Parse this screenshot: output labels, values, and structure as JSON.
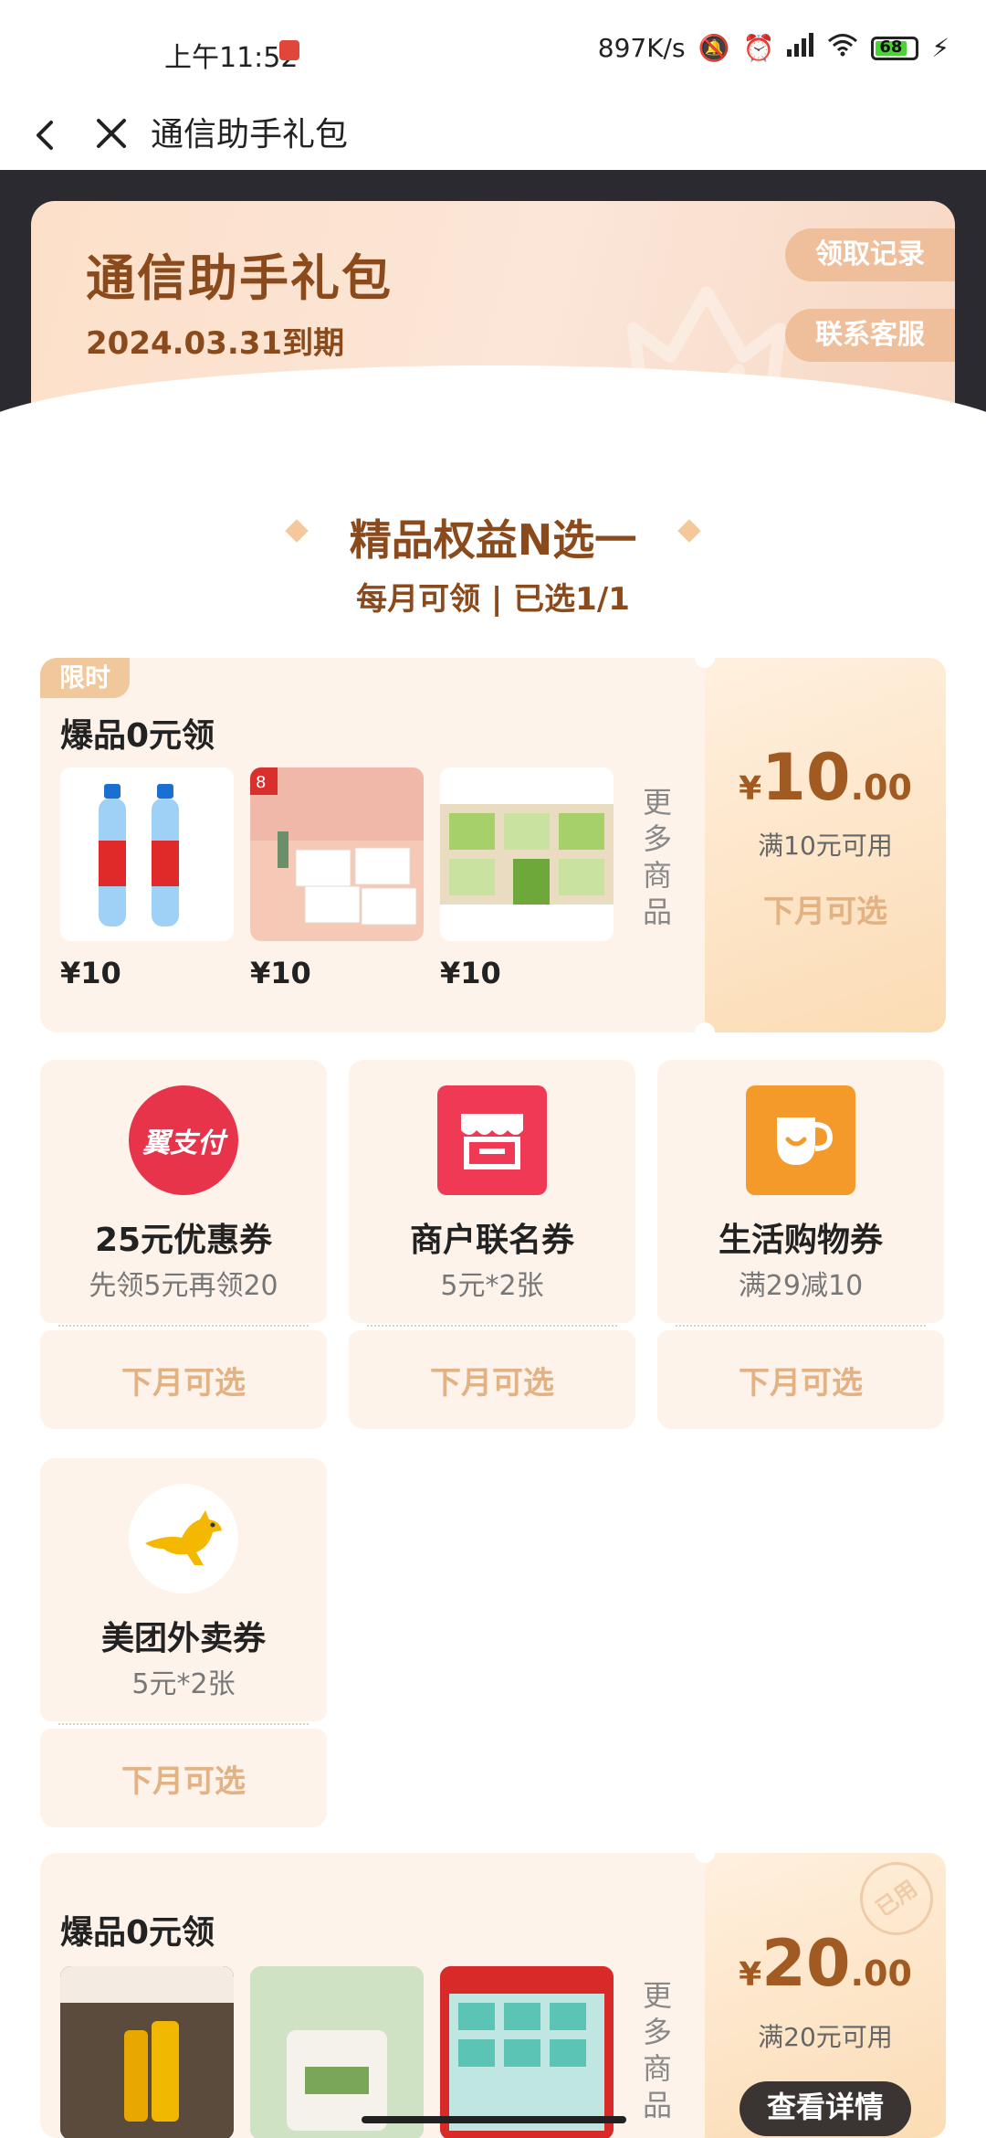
{
  "status_bar": {
    "time": "上午11:52",
    "net_speed": "897K/s",
    "battery": "68"
  },
  "nav": {
    "title": "通信助手礼包"
  },
  "header": {
    "title": "通信助手礼包",
    "expiry": "2024.03.31到期",
    "records_button": "领取记录",
    "service_button": "联系客服"
  },
  "section": {
    "title": "精品权益N选一",
    "subtitle": "每月可领 | 已选1/1"
  },
  "product_cards": [
    {
      "tag": "限时",
      "title": "爆品0元领",
      "prices": [
        "¥10",
        "¥10",
        "¥10"
      ],
      "more": "更多商品",
      "currency": "¥",
      "amount_int": "10",
      "amount_dec": ".00",
      "condition": "满10元可用",
      "action": "下月可选"
    },
    {
      "title": "爆品0元领",
      "more": "更多商品",
      "currency": "¥",
      "amount_int": "20",
      "amount_dec": ".00",
      "condition": "满20元可用",
      "action": "查看详情",
      "stamp": "已用"
    }
  ],
  "coupons": [
    {
      "name": "25元优惠券",
      "desc": "先领5元再领20",
      "action": "下月可选",
      "icon": "yizhifu-logo-icon",
      "icon_text": "翼支付",
      "color": "#e8344a"
    },
    {
      "name": "商户联名券",
      "desc": "5元*2张",
      "action": "下月可选",
      "icon": "store-icon",
      "color": "#f03a55"
    },
    {
      "name": "生活购物券",
      "desc": "满29减10",
      "action": "下月可选",
      "icon": "cup-icon",
      "color": "#f39a2a"
    },
    {
      "name": "美团外卖券",
      "desc": "5元*2张",
      "action": "下月可选",
      "icon": "kangaroo-icon",
      "color": "#f5b800"
    }
  ]
}
